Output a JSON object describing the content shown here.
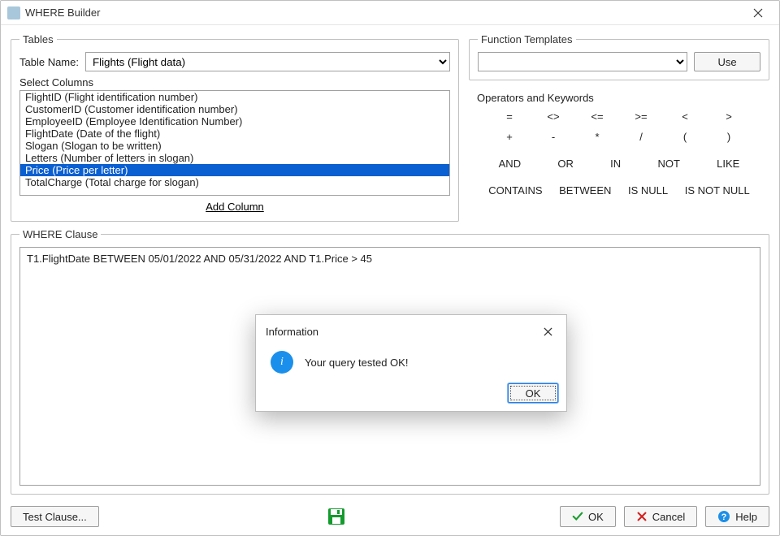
{
  "window": {
    "title": "WHERE Builder"
  },
  "tables": {
    "legend": "Tables",
    "table_label": "Table Name:",
    "table_selected": "Flights  (Flight data)",
    "select_cols_label": "Select Columns",
    "columns": [
      {
        "text": "FlightID  (Flight identification number)",
        "selected": false
      },
      {
        "text": "CustomerID  (Customer identification number)",
        "selected": false
      },
      {
        "text": "EmployeeID  (Employee Identification Number)",
        "selected": false
      },
      {
        "text": "FlightDate  (Date of the flight)",
        "selected": false
      },
      {
        "text": "Slogan  (Slogan to be written)",
        "selected": false
      },
      {
        "text": "Letters  (Number of letters in slogan)",
        "selected": false
      },
      {
        "text": "Price  (Price per letter)",
        "selected": true
      },
      {
        "text": "TotalCharge  (Total charge for slogan)",
        "selected": false
      }
    ],
    "add_column": "Add Column"
  },
  "functions": {
    "legend": "Function Templates",
    "use_label": "Use"
  },
  "operators": {
    "legend": "Operators and Keywords",
    "row1": [
      "=",
      "<>",
      "<=",
      ">=",
      "<",
      ">"
    ],
    "row2": [
      "+",
      "-",
      "*",
      "/",
      "(",
      ")"
    ],
    "row3": [
      "AND",
      "OR",
      "IN",
      "NOT",
      "LIKE"
    ],
    "row4": [
      "CONTAINS",
      "BETWEEN",
      "IS NULL",
      "IS NOT NULL"
    ]
  },
  "where": {
    "legend": "WHERE Clause",
    "text": "T1.FlightDate   BETWEEN 05/01/2022  AND 05/31/2022 AND  T1.Price  > 45"
  },
  "buttons": {
    "test_clause": "Test Clause...",
    "ok": "OK",
    "cancel": "Cancel",
    "help": "Help"
  },
  "dialog": {
    "title": "Information",
    "message": "Your query tested OK!",
    "ok": "OK"
  }
}
